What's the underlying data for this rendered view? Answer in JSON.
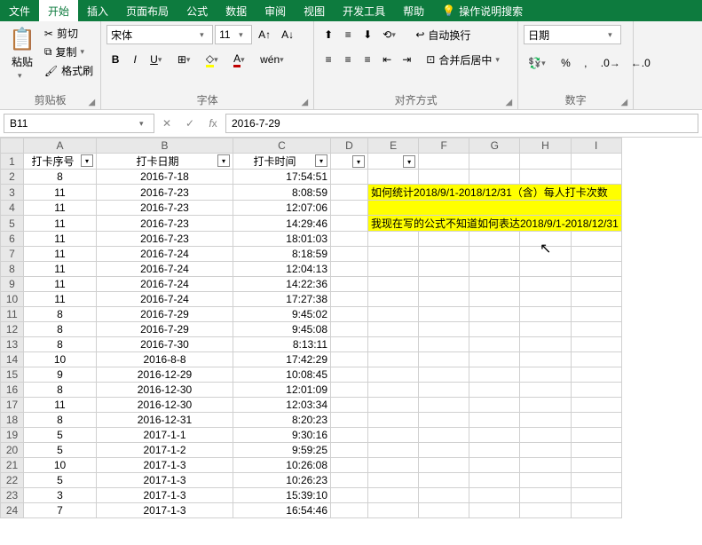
{
  "tabs": {
    "file": "文件",
    "home": "开始",
    "insert": "插入",
    "layout": "页面布局",
    "formula": "公式",
    "data": "数据",
    "review": "审阅",
    "view": "视图",
    "dev": "开发工具",
    "help": "帮助",
    "tell": "操作说明搜索"
  },
  "ribbon": {
    "clipboard": {
      "label": "剪贴板",
      "paste": "粘贴",
      "cut": "剪切",
      "copy": "复制",
      "format": "格式刷"
    },
    "font": {
      "label": "字体",
      "name": "宋体",
      "size": "11",
      "wen": "wén"
    },
    "align": {
      "label": "对齐方式",
      "wrap": "自动换行",
      "merge": "合并后居中"
    },
    "number": {
      "label": "数字",
      "format": "日期",
      "pct": "%",
      "comma": ","
    }
  },
  "namebox": "B11",
  "formula": "2016-7-29",
  "columns": [
    "A",
    "B",
    "C",
    "D",
    "E",
    "F",
    "G",
    "H",
    "I"
  ],
  "widths": [
    82,
    154,
    110,
    42,
    54,
    54,
    54,
    54,
    54
  ],
  "headers": {
    "a": "打卡序号",
    "b": "打卡日期",
    "c": "打卡时间"
  },
  "note": "如何统计2018/9/1-2018/12/31（含）每人打卡次数",
  "note2": "我现在写的公式不知道如何表达2018/9/1-2018/12/31",
  "rows": [
    {
      "n": 1,
      "a": "8",
      "b": "2016-7-18",
      "c": "17:54:51"
    },
    {
      "n": 2,
      "a": "11",
      "b": "2016-7-23",
      "c": "8:08:59"
    },
    {
      "n": 3,
      "a": "11",
      "b": "2016-7-23",
      "c": "12:07:06"
    },
    {
      "n": 4,
      "a": "11",
      "b": "2016-7-23",
      "c": "14:29:46"
    },
    {
      "n": 5,
      "a": "11",
      "b": "2016-7-23",
      "c": "18:01:03"
    },
    {
      "n": 6,
      "a": "11",
      "b": "2016-7-24",
      "c": "8:18:59"
    },
    {
      "n": 7,
      "a": "11",
      "b": "2016-7-24",
      "c": "12:04:13"
    },
    {
      "n": 8,
      "a": "11",
      "b": "2016-7-24",
      "c": "14:22:36"
    },
    {
      "n": 9,
      "a": "11",
      "b": "2016-7-24",
      "c": "17:27:38"
    },
    {
      "n": 10,
      "a": "8",
      "b": "2016-7-29",
      "c": "9:45:02"
    },
    {
      "n": 11,
      "a": "8",
      "b": "2016-7-29",
      "c": "9:45:08"
    },
    {
      "n": 12,
      "a": "8",
      "b": "2016-7-30",
      "c": "8:13:11"
    },
    {
      "n": 13,
      "a": "10",
      "b": "2016-8-8",
      "c": "17:42:29"
    },
    {
      "n": 14,
      "a": "9",
      "b": "2016-12-29",
      "c": "10:08:45"
    },
    {
      "n": 15,
      "a": "8",
      "b": "2016-12-30",
      "c": "12:01:09"
    },
    {
      "n": 16,
      "a": "11",
      "b": "2016-12-30",
      "c": "12:03:34"
    },
    {
      "n": 17,
      "a": "8",
      "b": "2016-12-31",
      "c": "8:20:23"
    },
    {
      "n": 18,
      "a": "5",
      "b": "2017-1-1",
      "c": "9:30:16"
    },
    {
      "n": 19,
      "a": "5",
      "b": "2017-1-2",
      "c": "9:59:25"
    },
    {
      "n": 20,
      "a": "10",
      "b": "2017-1-3",
      "c": "10:26:08"
    },
    {
      "n": 21,
      "a": "5",
      "b": "2017-1-3",
      "c": "10:26:23"
    },
    {
      "n": 22,
      "a": "3",
      "b": "2017-1-3",
      "c": "15:39:10"
    },
    {
      "n": 23,
      "a": "7",
      "b": "2017-1-3",
      "c": "16:54:46"
    }
  ]
}
